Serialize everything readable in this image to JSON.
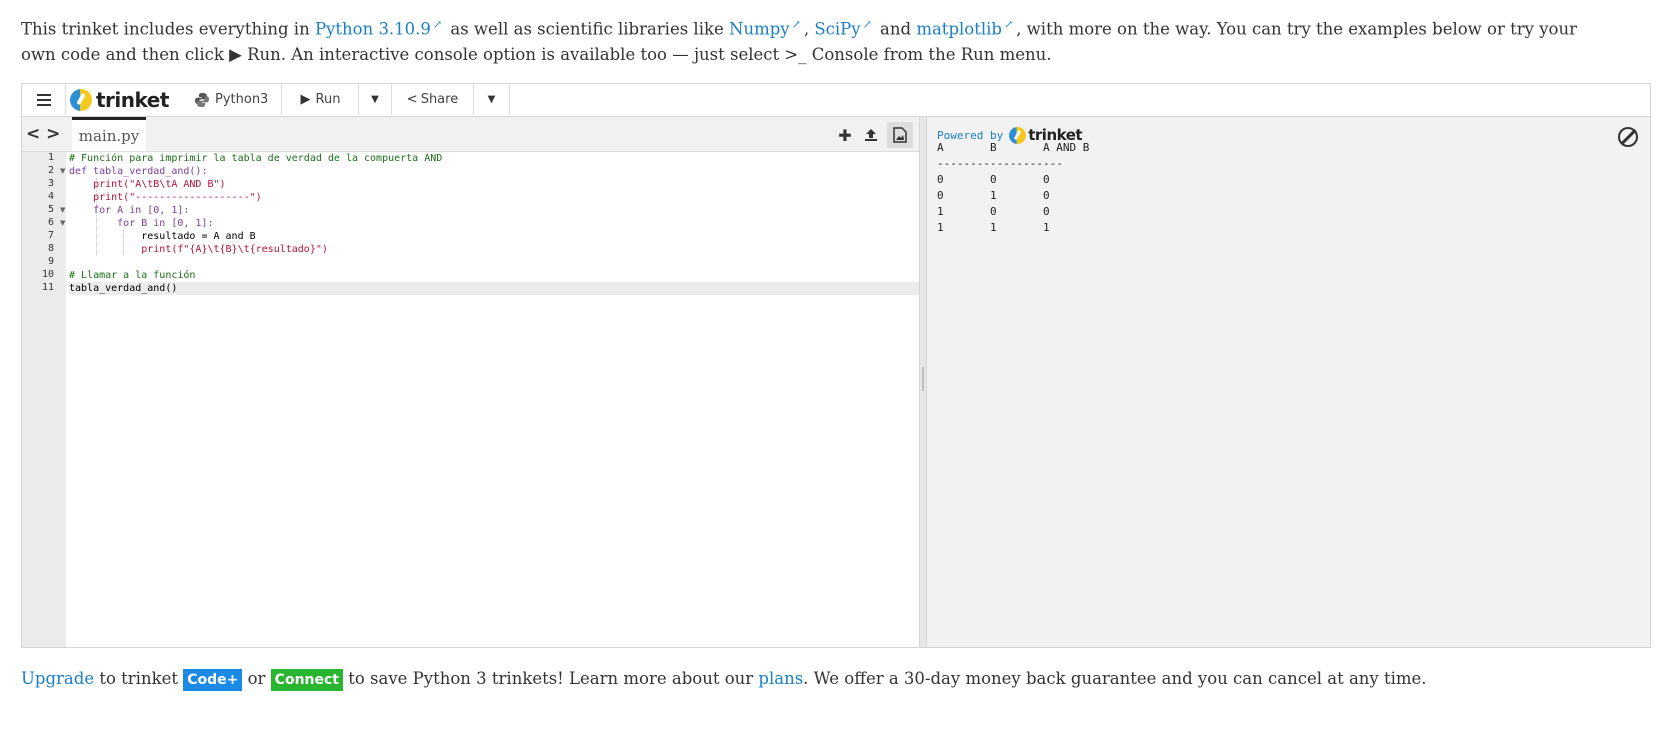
{
  "intro": {
    "t1": "This trinket includes everything in ",
    "python_link": "Python 3.10.9",
    "t2": " as well as scientific libraries like ",
    "numpy_link": "Numpy",
    "t3": ", ",
    "scipy_link": "SciPy",
    "t4": " and ",
    "matplotlib_link": "matplotlib",
    "t5": ", with more on the way. You can try the examples below or try your own code and then click ",
    "run_glyph": "▶",
    "t6": " Run. An interactive console option is available too — just select ",
    "console_glyph": ">_",
    "t7": " Console from the Run menu."
  },
  "toolbar": {
    "menu_icon": "hamburger-icon",
    "logo_text": "trinket",
    "language": "Python3",
    "run_label": "Run",
    "share_label": "Share"
  },
  "editor": {
    "tab_label": "main.py",
    "line_numbers": [
      "1",
      "2",
      "3",
      "4",
      "5",
      "6",
      "7",
      "8",
      "9",
      "10",
      "11"
    ],
    "lines": [
      "# Función para imprimir la tabla de verdad de la compuerta AND",
      "def tabla_verdad_and():",
      "    print(\"A\\tB\\tA AND B\")",
      "    print(\"-------------------\")",
      "    for A in [0, 1]:",
      "        for B in [0, 1]:",
      "            resultado = A and B",
      "            print(f\"{A}\\t{B}\\t{resultado}\")",
      "",
      "# Llamar a la función",
      "tabla_verdad_and()"
    ]
  },
  "console": {
    "powered_by": "Powered by",
    "logo_text": "trinket",
    "output": [
      "A       B       A AND B",
      "-------------------",
      "0       0       0",
      "0       1       0",
      "1       0       0",
      "1       1       1"
    ]
  },
  "footer": {
    "upgrade_link": "Upgrade",
    "t1": " to trinket ",
    "codeplus_badge": "Code+",
    "t2": " or ",
    "connect_badge": "Connect",
    "t3": " to save Python 3 trinkets! Learn more about our ",
    "plans_link": "plans",
    "t4": ". We offer a 30-day money back guarantee and you can cancel at any time."
  },
  "colors": {
    "link": "#1a7fc4",
    "codeplus": "#1a8ae6",
    "connect": "#2ab530",
    "keyword": "#7a3e9d",
    "comment": "#1a6f1a",
    "string": "#b3123b"
  }
}
